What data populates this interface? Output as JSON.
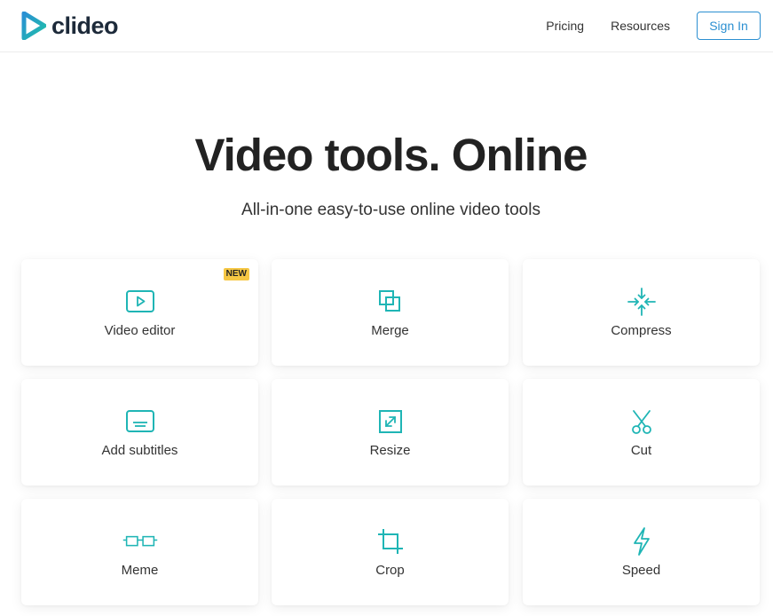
{
  "brand": {
    "name": "clideo",
    "accent": "#1fb5b5",
    "link_color": "#2b8fd1"
  },
  "nav": {
    "items": [
      "Pricing",
      "Resources"
    ],
    "signin_label": "Sign In"
  },
  "hero": {
    "title": "Video tools. Online",
    "subtitle": "All-in-one easy-to-use online video tools"
  },
  "tools": [
    {
      "label": "Video editor",
      "icon": "play-icon",
      "badge": "NEW"
    },
    {
      "label": "Merge",
      "icon": "merge-icon"
    },
    {
      "label": "Compress",
      "icon": "compress-icon"
    },
    {
      "label": "Add subtitles",
      "icon": "subtitles-icon"
    },
    {
      "label": "Resize",
      "icon": "resize-icon"
    },
    {
      "label": "Cut",
      "icon": "scissors-icon"
    },
    {
      "label": "Meme",
      "icon": "glasses-icon"
    },
    {
      "label": "Crop",
      "icon": "crop-icon"
    },
    {
      "label": "Speed",
      "icon": "lightning-icon"
    }
  ]
}
